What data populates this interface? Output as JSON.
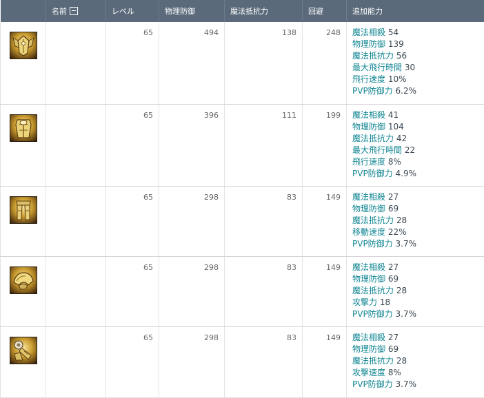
{
  "header": {
    "name": "名前",
    "level": "レベル",
    "physical_def": "物理防御",
    "magic_res": "魔法抵抗力",
    "evasion": "回避",
    "extra": "追加能力"
  },
  "rows": [
    {
      "icon": "winged-helm-armor-icon",
      "level": "65",
      "pdef": "494",
      "mres": "138",
      "evasion": "248",
      "opts": [
        {
          "name": "魔法相殺",
          "value": "54"
        },
        {
          "name": "物理防御",
          "value": "139"
        },
        {
          "name": "魔法抵抗力",
          "value": "56"
        },
        {
          "name": "最大飛行時間",
          "value": "30"
        },
        {
          "name": "飛行速度",
          "value": "10%"
        },
        {
          "name": "PVP防御力",
          "value": "6.2%"
        }
      ]
    },
    {
      "icon": "golden-cuirass-icon",
      "level": "65",
      "pdef": "396",
      "mres": "111",
      "evasion": "199",
      "opts": [
        {
          "name": "魔法相殺",
          "value": "41"
        },
        {
          "name": "物理防御",
          "value": "104"
        },
        {
          "name": "魔法抵抗力",
          "value": "42"
        },
        {
          "name": "最大飛行時間",
          "value": "22"
        },
        {
          "name": "飛行速度",
          "value": "8%"
        },
        {
          "name": "PVP防御力",
          "value": "4.9%"
        }
      ]
    },
    {
      "icon": "leg-guards-icon",
      "level": "65",
      "pdef": "298",
      "mres": "83",
      "evasion": "149",
      "opts": [
        {
          "name": "魔法相殺",
          "value": "27"
        },
        {
          "name": "物理防御",
          "value": "69"
        },
        {
          "name": "魔法抵抗力",
          "value": "28"
        },
        {
          "name": "移動速度",
          "value": "22%"
        }
      ]
    },
    {
      "icon": "pauldrons-icon",
      "level": "65",
      "pdef": "298",
      "mres": "83",
      "evasion": "149",
      "opts": [
        {
          "name": "魔法相殺",
          "value": "27"
        },
        {
          "name": "物理防御",
          "value": "69"
        },
        {
          "name": "魔法抵抗力",
          "value": "28"
        },
        {
          "name": "攻撃力",
          "value": "18"
        },
        {
          "name": "PVP防御力",
          "value": "3.7%"
        }
      ]
    },
    {
      "icon": "gauntlets-icon",
      "level": "65",
      "pdef": "298",
      "mres": "83",
      "evasion": "149",
      "opts": [
        {
          "name": "魔法相殺",
          "value": "27"
        },
        {
          "name": "物理防御",
          "value": "69"
        },
        {
          "name": "魔法抵抗力",
          "value": "28"
        },
        {
          "name": "攻撃速度",
          "value": "8%"
        },
        {
          "name": "PVP防御力",
          "value": "3.7%"
        }
      ]
    }
  ],
  "row3_pvp": {
    "name": "PVP防御力",
    "value": "3.7%"
  },
  "colors": {
    "header_bg": "#5a6a7a",
    "option_text": "#0f8592",
    "border": "#e3e3e3"
  }
}
